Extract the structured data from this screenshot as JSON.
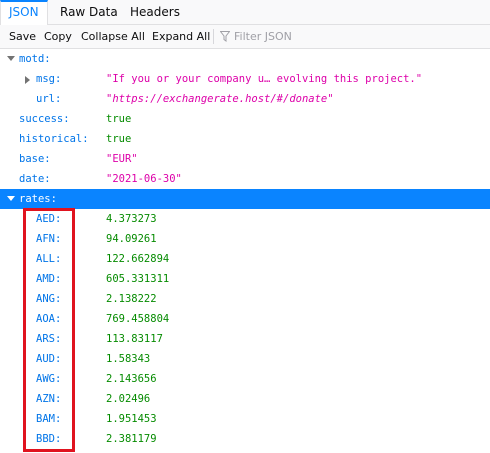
{
  "tabs": [
    {
      "label": "JSON",
      "selected": true
    },
    {
      "label": "Raw Data",
      "selected": false
    },
    {
      "label": "Headers",
      "selected": false
    }
  ],
  "toolbar": {
    "save": "Save",
    "copy": "Copy",
    "collapse_all": "Collapse All",
    "expand_all": "Expand All",
    "filter_placeholder": "Filter JSON"
  },
  "tree": {
    "motd": {
      "key": "motd:",
      "msg_key": "msg:",
      "msg_val": "\"If you or your company u… evolving this project.\"",
      "url_key": "url:",
      "url_val": "\"https://exchangerate.host/#/donate\""
    },
    "success": {
      "key": "success:",
      "val": "true"
    },
    "historical": {
      "key": "historical:",
      "val": "true"
    },
    "base": {
      "key": "base:",
      "val": "\"EUR\""
    },
    "date": {
      "key": "date:",
      "val": "\"2021-06-30\""
    },
    "rates_key": "rates:",
    "rates": [
      {
        "key": "AED:",
        "val": "4.373273"
      },
      {
        "key": "AFN:",
        "val": "94.09261"
      },
      {
        "key": "ALL:",
        "val": "122.662894"
      },
      {
        "key": "AMD:",
        "val": "605.331311"
      },
      {
        "key": "ANG:",
        "val": "2.138222"
      },
      {
        "key": "AOA:",
        "val": "769.458804"
      },
      {
        "key": "ARS:",
        "val": "113.83117"
      },
      {
        "key": "AUD:",
        "val": "1.58343"
      },
      {
        "key": "AWG:",
        "val": "2.143656"
      },
      {
        "key": "AZN:",
        "val": "2.02496"
      },
      {
        "key": "BAM:",
        "val": "1.951453"
      },
      {
        "key": "BBD:",
        "val": "2.381179"
      }
    ]
  },
  "colors": {
    "accent": "#0a84ff",
    "key": "#0074e8",
    "string": "#dd00a9",
    "number": "#058b00",
    "highlight_box": "#e0131f"
  }
}
